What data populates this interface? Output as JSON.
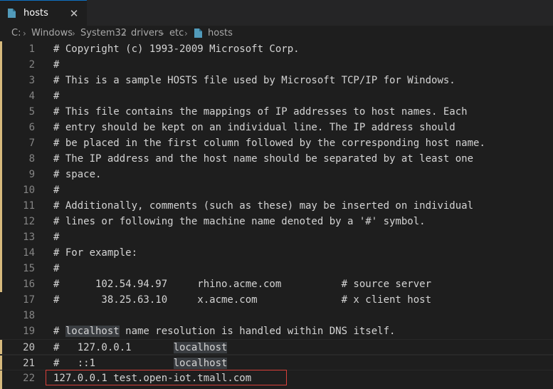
{
  "tab": {
    "label": "hosts",
    "close_glyph": "✕",
    "icon": "file-icon"
  },
  "breadcrumb": {
    "items": [
      "C:",
      "Windows",
      "System32",
      "drivers",
      "etc",
      "hosts"
    ],
    "separator": "›",
    "file_icon": "file-icon"
  },
  "editor": {
    "lines": [
      {
        "n": "1",
        "text": "# Copyright (c) 1993-2009 Microsoft Corp."
      },
      {
        "n": "2",
        "text": "#"
      },
      {
        "n": "3",
        "text": "# This is a sample HOSTS file used by Microsoft TCP/IP for Windows."
      },
      {
        "n": "4",
        "text": "#"
      },
      {
        "n": "5",
        "text": "# This file contains the mappings of IP addresses to host names. Each"
      },
      {
        "n": "6",
        "text": "# entry should be kept on an individual line. The IP address should"
      },
      {
        "n": "7",
        "text": "# be placed in the first column followed by the corresponding host name."
      },
      {
        "n": "8",
        "text": "# The IP address and the host name should be separated by at least one"
      },
      {
        "n": "9",
        "text": "# space."
      },
      {
        "n": "10",
        "text": "#"
      },
      {
        "n": "11",
        "text": "# Additionally, comments (such as these) may be inserted on individual"
      },
      {
        "n": "12",
        "text": "# lines or following the machine name denoted by a '#' symbol."
      },
      {
        "n": "13",
        "text": "#"
      },
      {
        "n": "14",
        "text": "# For example:"
      },
      {
        "n": "15",
        "text": "#"
      },
      {
        "n": "16",
        "text": "#      102.54.94.97     rhino.acme.com          # source server"
      },
      {
        "n": "17",
        "text": "#       38.25.63.10     x.acme.com              # x client host"
      },
      {
        "n": "18",
        "text": ""
      },
      {
        "n": "19",
        "pre": "# ",
        "hl": "localhost",
        "post": " name resolution is handled within DNS itself."
      },
      {
        "n": "20",
        "pre": "#   127.0.0.1       ",
        "hl": "localhost",
        "post": ""
      },
      {
        "n": "21",
        "pre": "#   ::1             ",
        "hl": "localhost",
        "post": ""
      },
      {
        "n": "22",
        "text": "127.0.0.1 test.open-iot.tmall.com"
      }
    ],
    "current_lines": [
      "20",
      "21"
    ],
    "highlight_word": "localhost",
    "annotation": "red rectangle around line 22",
    "colors": {
      "background": "#1e1e1e",
      "text": "#d4d4d4",
      "line_number": "#858585",
      "word_highlight": "#3a3d41",
      "annotation_box": "#d9403a",
      "tab_accent": "#0e70c0"
    }
  }
}
